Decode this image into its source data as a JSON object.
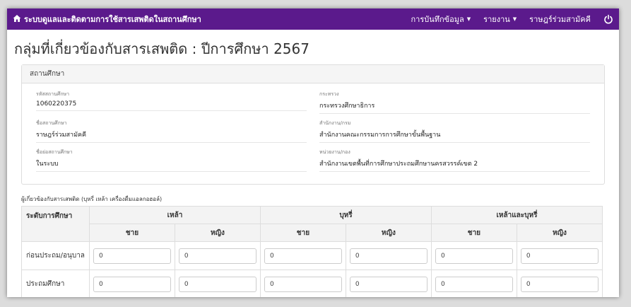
{
  "navbar": {
    "brand_icon": "home-icon",
    "brand_title": "ระบบดูแลและติดตามการใช้สารเสพติดในสถานศึกษา",
    "menu": [
      {
        "label": "การบันทึกข้อมูล",
        "has_dropdown": true
      },
      {
        "label": "รายงาน",
        "has_dropdown": true
      },
      {
        "label": "ราษฎร์ร่วมสามัคคี",
        "has_dropdown": false
      }
    ],
    "power_icon": "power-icon",
    "bg_color": "#5b1a8c"
  },
  "page_title": "กลุ่มที่เกี่ยวข้องกับสารเสพติด : ปีการศึกษา 2567",
  "school_panel": {
    "heading": "สถานศึกษา",
    "fields": [
      {
        "label": "รหัสสถานศึกษา",
        "value": "1060220375"
      },
      {
        "label": "กระทรวง",
        "value": "กระทรวงศึกษาธิการ"
      },
      {
        "label": "ชื่อสถานศึกษา",
        "value": "ราษฎร์ร่วมสามัคคี"
      },
      {
        "label": "สำนักงาน/กรม",
        "value": "สำนักงานคณะกรรมการการศึกษาขั้นพื้นฐาน"
      },
      {
        "label": "ชื่อย่อสถานศึกษา",
        "value": "ในระบบ"
      },
      {
        "label": "หน่วยงาน/กอง",
        "value": "สำนักงานเขตพื้นที่การศึกษาประถมศึกษานครสวรรค์เขต 2"
      }
    ]
  },
  "section_label": "ผู้เกี่ยวข้องกับสารเสพติด (บุหรี่ เหล้า เครื่องดื่มแอลกอฮอล์)",
  "table": {
    "level_header": "ระดับการศึกษา",
    "groups": [
      "เหล้า",
      "บุหรี่",
      "เหล้าและบุหรี่"
    ],
    "genders": [
      "ชาย",
      "หญิง"
    ],
    "rows": [
      {
        "label": "ก่อนประถม/อนุบาล",
        "values": [
          "0",
          "0",
          "0",
          "0",
          "0",
          "0"
        ]
      },
      {
        "label": "ประถมศึกษา",
        "values": [
          "0",
          "0",
          "0",
          "0",
          "0",
          "0"
        ]
      }
    ]
  }
}
